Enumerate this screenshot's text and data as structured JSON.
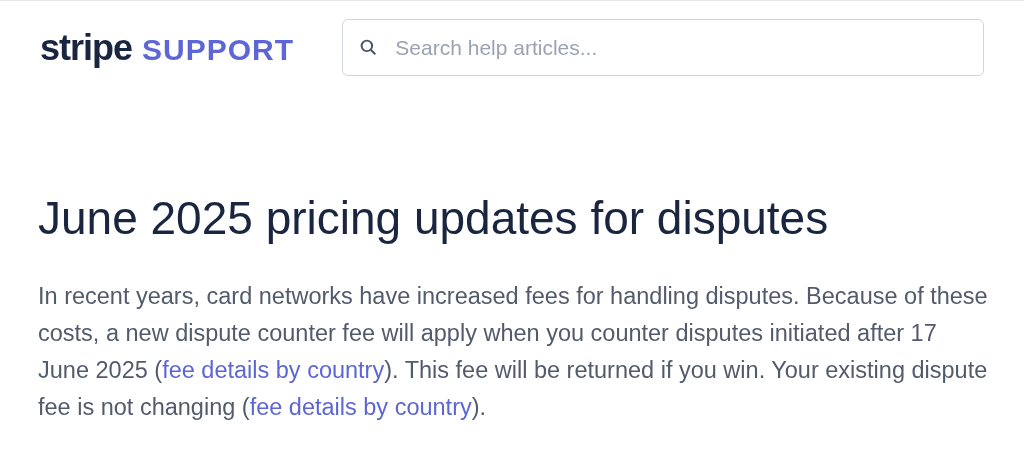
{
  "header": {
    "logo_brand": "stripe",
    "logo_section": "SUPPORT",
    "search": {
      "placeholder": "Search help articles..."
    }
  },
  "article": {
    "title": "June 2025 pricing updates for disputes",
    "intro": [
      {
        "kind": "text",
        "text": "In recent years, card networks have increased fees for handling disputes. Because of these costs, a new dispute counter fee will apply when you counter disputes initiated after 17 June 2025 ("
      },
      {
        "kind": "link",
        "text": "fee details by country"
      },
      {
        "kind": "text",
        "text": "). This fee will be returned if you win. Your existing dispute fee is not changing ("
      },
      {
        "kind": "link",
        "text": "fee details by country"
      },
      {
        "kind": "text",
        "text": ")."
      }
    ]
  }
}
